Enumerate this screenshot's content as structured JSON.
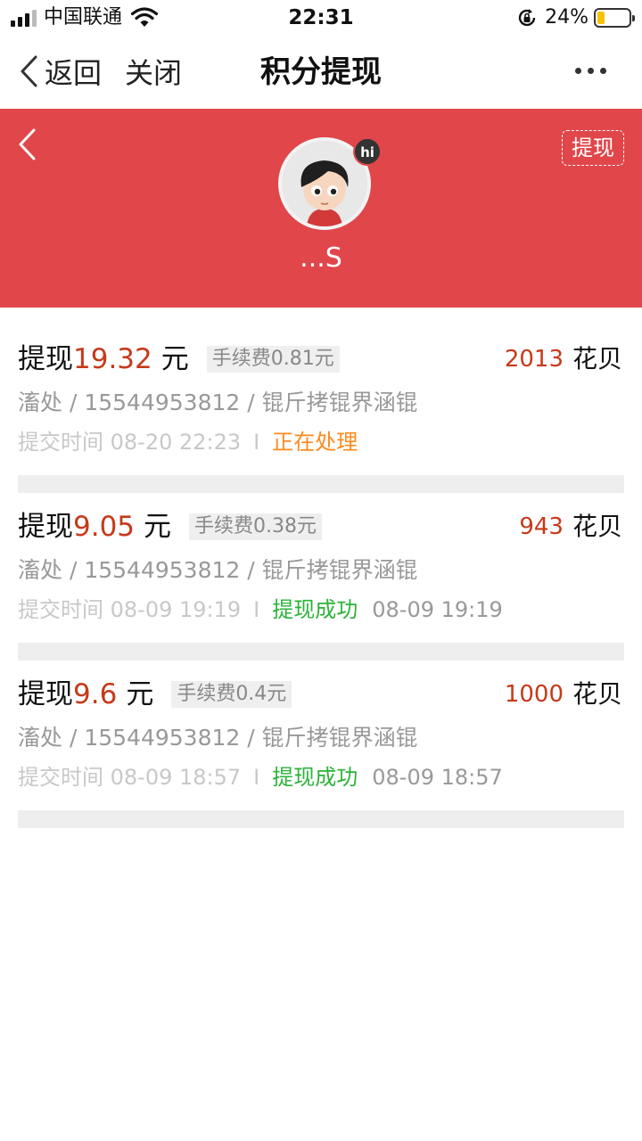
{
  "status_bar": {
    "carrier": "中国联通",
    "time": "22:31",
    "battery": "24%",
    "battery_level": 0.24,
    "battery_color": "#f4c400"
  },
  "nav": {
    "back_label": "返回",
    "close_label": "关闭",
    "title": "积分提现",
    "more_icon": "more-dots-icon"
  },
  "header": {
    "background": "#e0464a",
    "withdraw_tag": "提现",
    "hi_badge": "hi",
    "username": "...S"
  },
  "colors": {
    "amount": "#c63a1a",
    "processing": "#ff8a1e",
    "success": "#2bb33a"
  },
  "records": [
    {
      "label": "提现",
      "amount": "19.32",
      "unit": "元",
      "fee": "手续费0.81元",
      "points": "2013",
      "points_unit": "花贝",
      "account": "滀处 / 15544953812 / 锟斤拷锟界涵锟",
      "submit_time": "提交时间 08-20 22:23",
      "separator": "I",
      "status": "正在处理",
      "status_color": "#ff8a1e",
      "done_time": ""
    },
    {
      "label": "提现",
      "amount": "9.05",
      "unit": "元",
      "fee": "手续费0.38元",
      "points": "943",
      "points_unit": "花贝",
      "account": "滀处 / 15544953812 / 锟斤拷锟界涵锟",
      "submit_time": "提交时间 08-09 19:19",
      "separator": "I",
      "status": "提现成功",
      "status_color": "#2bb33a",
      "done_time": "08-09 19:19"
    },
    {
      "label": "提现",
      "amount": "9.6",
      "unit": "元",
      "fee": "手续费0.4元",
      "points": "1000",
      "points_unit": "花贝",
      "account": "滀处 / 15544953812 / 锟斤拷锟界涵锟",
      "submit_time": "提交时间 08-09 18:57",
      "separator": "I",
      "status": "提现成功",
      "status_color": "#2bb33a",
      "done_time": "08-09 18:57"
    }
  ]
}
